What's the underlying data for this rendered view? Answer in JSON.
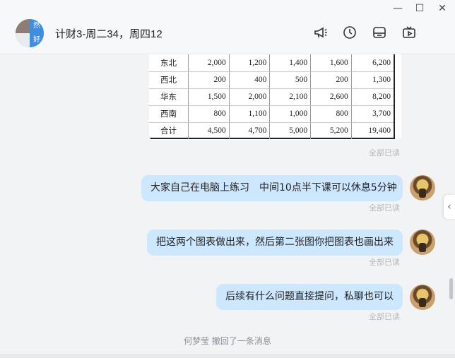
{
  "window": {
    "controls": {
      "minimize": "—",
      "maximize": "☐",
      "close": "✕"
    }
  },
  "header": {
    "title": "计财3-周二34，周四12",
    "avatar_chars": [
      "然",
      "好"
    ],
    "icons": [
      "announcement-icon",
      "history-icon",
      "folder-icon",
      "live-icon"
    ]
  },
  "table": {
    "rows": [
      {
        "region": "东北",
        "values": [
          "2,000",
          "1,200",
          "1,400",
          "1,600",
          "6,200"
        ]
      },
      {
        "region": "西北",
        "values": [
          "200",
          "400",
          "500",
          "200",
          "1,300"
        ]
      },
      {
        "region": "华东",
        "values": [
          "1,500",
          "2,000",
          "2,100",
          "2,600",
          "8,200"
        ]
      },
      {
        "region": "西南",
        "values": [
          "800",
          "1,100",
          "1,000",
          "800",
          "3,700"
        ]
      },
      {
        "region": "合计",
        "values": [
          "4,500",
          "4,700",
          "5,000",
          "5,200",
          "19,400"
        ]
      }
    ]
  },
  "messages": [
    {
      "text": "大家自己在电脑上练习　中间10点半下课可以休息5分钟",
      "status": "全部已读"
    },
    {
      "text": "把这两个图表做出来，然后第二张图你把图表也画出来",
      "status": "全部已读"
    },
    {
      "text": "后续有什么问题直接提问，私聊也可以",
      "status": "全部已读"
    }
  ],
  "table_status": "全部已读",
  "notice": "何梦莹 撤回了一条消息",
  "side_tab_glyph": "‹"
}
